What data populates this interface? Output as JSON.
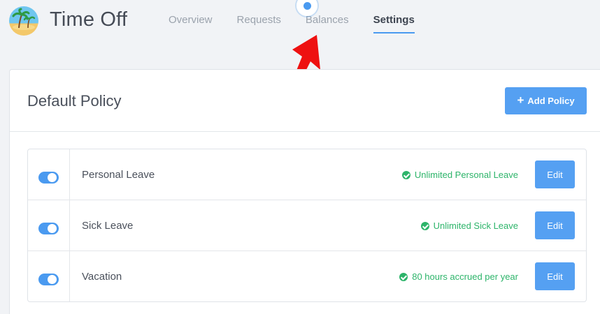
{
  "app": {
    "title": "Time Off",
    "logo_icon": "beach-palm-icon"
  },
  "tabs": [
    {
      "label": "Overview",
      "active": false
    },
    {
      "label": "Requests",
      "active": false
    },
    {
      "label": "Balances",
      "active": false
    },
    {
      "label": "Settings",
      "active": true
    }
  ],
  "card": {
    "title": "Default Policy",
    "add_button_label": "Add Policy",
    "add_button_icon": "plus-icon"
  },
  "policies": [
    {
      "name": "Personal Leave",
      "status": "Unlimited Personal Leave",
      "edit_label": "Edit",
      "enabled": true
    },
    {
      "name": "Sick Leave",
      "status": "Unlimited Sick Leave",
      "edit_label": "Edit",
      "enabled": true
    },
    {
      "name": "Vacation",
      "status": "80 hours accrued per year",
      "edit_label": "Edit",
      "enabled": true
    }
  ],
  "colors": {
    "accent": "#55a0f2",
    "success": "#2db46a",
    "annotation_arrow": "#ee1111"
  }
}
